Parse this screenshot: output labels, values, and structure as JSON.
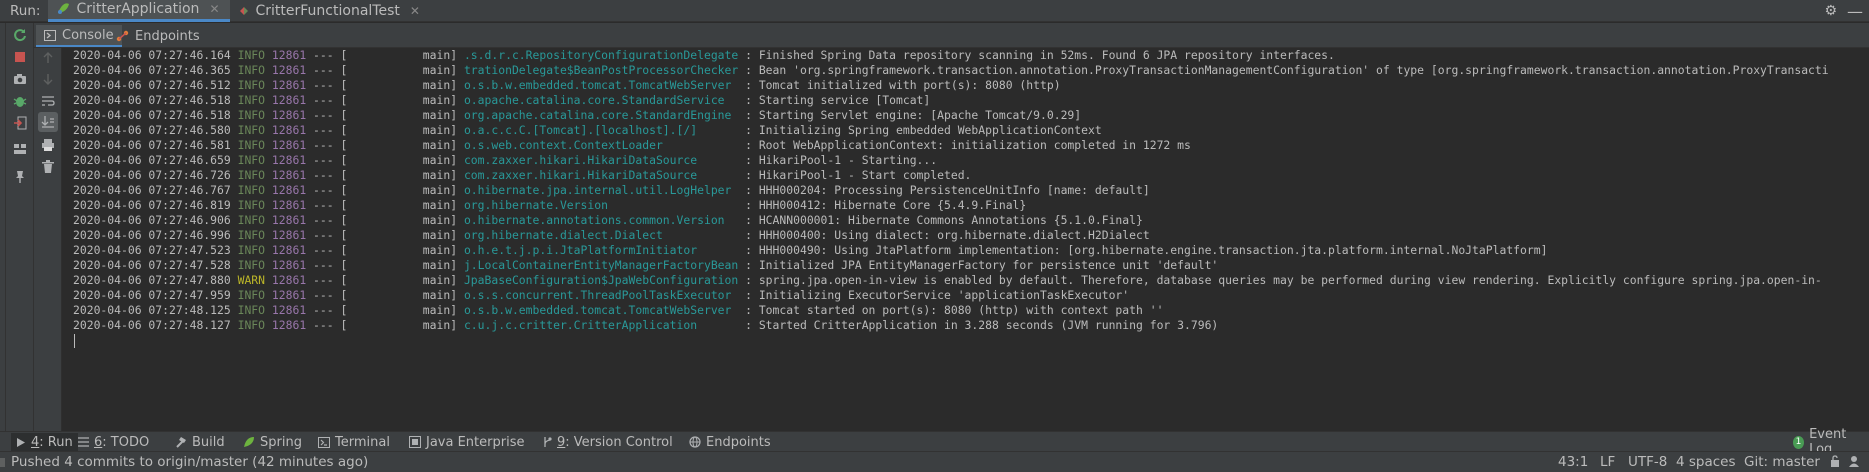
{
  "run_bar": {
    "label": "Run:",
    "tabs": [
      {
        "label": "CritterApplication",
        "active": true
      },
      {
        "label": "CritterFunctionalTest",
        "active": false
      }
    ]
  },
  "console_tabs": [
    {
      "label": "Console",
      "icon": "console-icon",
      "active": true
    },
    {
      "label": "Endpoints",
      "icon": "endpoints-icon",
      "active": false
    }
  ],
  "log_lines": [
    {
      "ts": "2020-04-06 07:27:46.164",
      "level": "INFO",
      "pid": "12861",
      "sep": "---",
      "thread": "[           main]",
      "logger": ".s.d.r.c.RepositoryConfigurationDelegate",
      "msg": ": Finished Spring Data repository scanning in 52ms. Found 6 JPA repository interfaces."
    },
    {
      "ts": "2020-04-06 07:27:46.365",
      "level": "INFO",
      "pid": "12861",
      "sep": "---",
      "thread": "[           main]",
      "logger": "trationDelegate$BeanPostProcessorChecker",
      "msg": ": Bean 'org.springframework.transaction.annotation.ProxyTransactionManagementConfiguration' of type [org.springframework.transaction.annotation.ProxyTransacti"
    },
    {
      "ts": "2020-04-06 07:27:46.512",
      "level": "INFO",
      "pid": "12861",
      "sep": "---",
      "thread": "[           main]",
      "logger": "o.s.b.w.embedded.tomcat.TomcatWebServer ",
      "msg": ": Tomcat initialized with port(s): 8080 (http)"
    },
    {
      "ts": "2020-04-06 07:27:46.518",
      "level": "INFO",
      "pid": "12861",
      "sep": "---",
      "thread": "[           main]",
      "logger": "o.apache.catalina.core.StandardService  ",
      "msg": ": Starting service [Tomcat]"
    },
    {
      "ts": "2020-04-06 07:27:46.518",
      "level": "INFO",
      "pid": "12861",
      "sep": "---",
      "thread": "[           main]",
      "logger": "org.apache.catalina.core.StandardEngine ",
      "msg": ": Starting Servlet engine: [Apache Tomcat/9.0.29]"
    },
    {
      "ts": "2020-04-06 07:27:46.580",
      "level": "INFO",
      "pid": "12861",
      "sep": "---",
      "thread": "[           main]",
      "logger": "o.a.c.c.C.[Tomcat].[localhost].[/]      ",
      "msg": ": Initializing Spring embedded WebApplicationContext"
    },
    {
      "ts": "2020-04-06 07:27:46.581",
      "level": "INFO",
      "pid": "12861",
      "sep": "---",
      "thread": "[           main]",
      "logger": "o.s.web.context.ContextLoader           ",
      "msg": ": Root WebApplicationContext: initialization completed in 1272 ms"
    },
    {
      "ts": "2020-04-06 07:27:46.659",
      "level": "INFO",
      "pid": "12861",
      "sep": "---",
      "thread": "[           main]",
      "logger": "com.zaxxer.hikari.HikariDataSource      ",
      "msg": ": HikariPool-1 - Starting..."
    },
    {
      "ts": "2020-04-06 07:27:46.726",
      "level": "INFO",
      "pid": "12861",
      "sep": "---",
      "thread": "[           main]",
      "logger": "com.zaxxer.hikari.HikariDataSource      ",
      "msg": ": HikariPool-1 - Start completed."
    },
    {
      "ts": "2020-04-06 07:27:46.767",
      "level": "INFO",
      "pid": "12861",
      "sep": "---",
      "thread": "[           main]",
      "logger": "o.hibernate.jpa.internal.util.LogHelper ",
      "msg": ": HHH000204: Processing PersistenceUnitInfo [name: default]"
    },
    {
      "ts": "2020-04-06 07:27:46.819",
      "level": "INFO",
      "pid": "12861",
      "sep": "---",
      "thread": "[           main]",
      "logger": "org.hibernate.Version                   ",
      "msg": ": HHH000412: Hibernate Core {5.4.9.Final}"
    },
    {
      "ts": "2020-04-06 07:27:46.906",
      "level": "INFO",
      "pid": "12861",
      "sep": "---",
      "thread": "[           main]",
      "logger": "o.hibernate.annotations.common.Version  ",
      "msg": ": HCANN000001: Hibernate Commons Annotations {5.1.0.Final}"
    },
    {
      "ts": "2020-04-06 07:27:46.996",
      "level": "INFO",
      "pid": "12861",
      "sep": "---",
      "thread": "[           main]",
      "logger": "org.hibernate.dialect.Dialect           ",
      "msg": ": HHH000400: Using dialect: org.hibernate.dialect.H2Dialect"
    },
    {
      "ts": "2020-04-06 07:27:47.523",
      "level": "INFO",
      "pid": "12861",
      "sep": "---",
      "thread": "[           main]",
      "logger": "o.h.e.t.j.p.i.JtaPlatformInitiator      ",
      "msg": ": HHH000490: Using JtaPlatform implementation: [org.hibernate.engine.transaction.jta.platform.internal.NoJtaPlatform]"
    },
    {
      "ts": "2020-04-06 07:27:47.528",
      "level": "INFO",
      "pid": "12861",
      "sep": "---",
      "thread": "[           main]",
      "logger": "j.LocalContainerEntityManagerFactoryBean",
      "msg": ": Initialized JPA EntityManagerFactory for persistence unit 'default'"
    },
    {
      "ts": "2020-04-06 07:27:47.880",
      "level": "WARN",
      "pid": "12861",
      "sep": "---",
      "thread": "[           main]",
      "logger": "JpaBaseConfiguration$JpaWebConfiguration",
      "msg": ": spring.jpa.open-in-view is enabled by default. Therefore, database queries may be performed during view rendering. Explicitly configure spring.jpa.open-in-"
    },
    {
      "ts": "2020-04-06 07:27:47.959",
      "level": "INFO",
      "pid": "12861",
      "sep": "---",
      "thread": "[           main]",
      "logger": "o.s.s.concurrent.ThreadPoolTaskExecutor ",
      "msg": ": Initializing ExecutorService 'applicationTaskExecutor'"
    },
    {
      "ts": "2020-04-06 07:27:48.125",
      "level": "INFO",
      "pid": "12861",
      "sep": "---",
      "thread": "[           main]",
      "logger": "o.s.b.w.embedded.tomcat.TomcatWebServer ",
      "msg": ": Tomcat started on port(s): 8080 (http) with context path ''"
    },
    {
      "ts": "2020-04-06 07:27:48.127",
      "level": "INFO",
      "pid": "12861",
      "sep": "---",
      "thread": "[           main]",
      "logger": "c.u.j.c.critter.CritterApplication      ",
      "msg": ": Started CritterApplication in 3.288 seconds (JVM running for 3.796)"
    }
  ],
  "tool_windows": {
    "run": {
      "num": "4",
      "label": ": Run"
    },
    "todo": {
      "num": "6",
      "label": ": TODO"
    },
    "build": {
      "label": "Build"
    },
    "spring": {
      "label": "Spring"
    },
    "terminal": {
      "label": "Terminal"
    },
    "java_enterprise": {
      "label": "Java Enterprise"
    },
    "vcs": {
      "num": "9",
      "label": ": Version Control"
    },
    "endpoints": {
      "label": "Endpoints"
    },
    "event_log": {
      "label": "Event Log",
      "badge": "1"
    }
  },
  "status_bar": {
    "message": "Pushed 4 commits to origin/master (42 minutes ago)",
    "position": "43:1",
    "line_sep": "LF",
    "encoding": "UTF-8",
    "indent": "4 spaces",
    "git": "Git: master"
  },
  "colors": {
    "info": "#6a8759",
    "warn": "#bbb529",
    "pid": "#9876aa",
    "logger": "#299999",
    "accent": "#4a88c7"
  }
}
